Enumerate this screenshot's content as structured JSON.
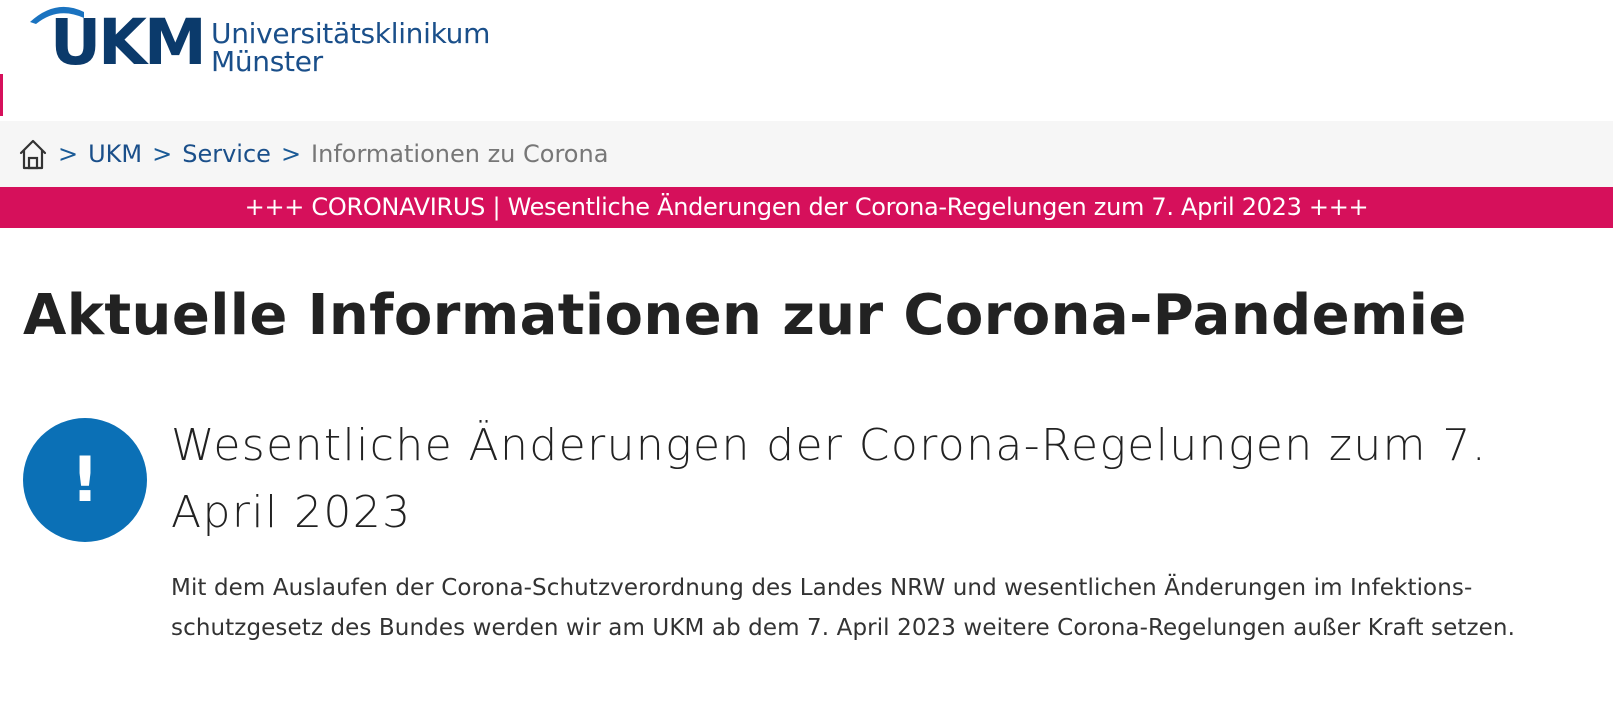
{
  "header": {
    "logo": {
      "abbrev": "UKM",
      "name_line1": "Universitätsklinikum",
      "name_line2": "Münster"
    }
  },
  "breadcrumb": {
    "home_icon": "home-icon",
    "separator": ">",
    "items": [
      {
        "label": "UKM"
      },
      {
        "label": "Service"
      },
      {
        "label": "Informationen zu Corona"
      }
    ]
  },
  "banner": {
    "text": "+++ CORONAVIRUS | Wesentliche Änderungen der Corona-Regelungen zum 7. April 2023 +++"
  },
  "main": {
    "title": "Aktuelle Informationen zur Corona-Pandemie",
    "notice": {
      "icon": "exclamation-icon",
      "icon_glyph": "!",
      "heading": "Wesentliche Änderungen der Corona-Regelungen zum 7. April 2023",
      "body": "Mit dem Auslaufen der Corona-Schutzverordnung des Landes NRW und wesentlichen Änderungen im Infektions-schutzgesetz des Bundes werden wir am UKM ab dem 7. April 2023 weitere Corona-Regelungen außer Kraft setzen."
    }
  },
  "colors": {
    "brand_dark_blue": "#0b3a6b",
    "brand_blue": "#1a4f8a",
    "accent_magenta": "#d6105b",
    "notice_blue": "#0b70b6",
    "breadcrumb_bg": "#f6f6f6"
  }
}
